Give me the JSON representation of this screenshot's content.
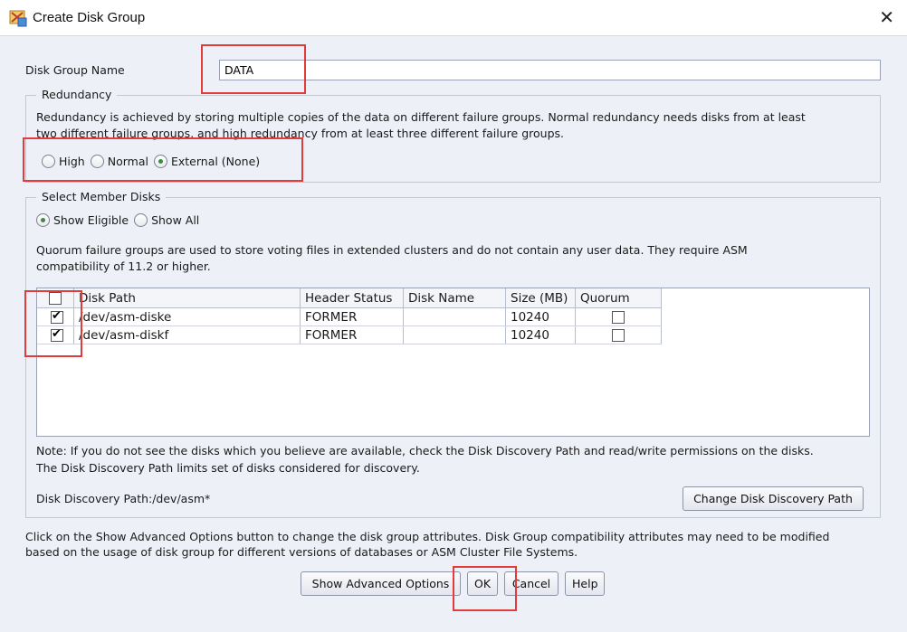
{
  "window": {
    "title": "Create Disk Group",
    "close_glyph": "✕"
  },
  "disk_group_name": {
    "label": "Disk Group Name",
    "value": "DATA"
  },
  "redundancy": {
    "legend": "Redundancy",
    "description_line1": "Redundancy is achieved by storing multiple copies of the data on different failure groups. Normal redundancy needs disks from at least",
    "description_line2": "two different failure groups, and high redundancy from at least three different failure groups.",
    "options": [
      {
        "label": "High",
        "selected": false
      },
      {
        "label": "Normal",
        "selected": false
      },
      {
        "label": "External (None)",
        "selected": true
      }
    ]
  },
  "member_disks": {
    "legend": "Select Member Disks",
    "filter_options": [
      {
        "label": "Show Eligible",
        "selected": true
      },
      {
        "label": "Show All",
        "selected": false
      }
    ],
    "quorum_note_line1": "Quorum failure groups are used to store voting files in extended clusters and do not contain any user data. They require ASM",
    "quorum_note_line2": "compatibility of 11.2 or higher.",
    "table": {
      "columns": [
        "",
        "Disk Path",
        "Header Status",
        "Disk Name",
        "Size (MB)",
        "Quorum"
      ],
      "rows": [
        {
          "selected": true,
          "path": "/dev/asm-diske",
          "header_status": "FORMER",
          "disk_name": "",
          "size_mb": "10240",
          "quorum": false
        },
        {
          "selected": true,
          "path": "/dev/asm-diskf",
          "header_status": "FORMER",
          "disk_name": "",
          "size_mb": "10240",
          "quorum": false
        }
      ]
    },
    "discovery_note_line1": "Note: If you do not see the disks which you believe are available, check the Disk Discovery Path and read/write permissions on the disks.",
    "discovery_note_line2": "The Disk Discovery Path limits set of disks considered for discovery.",
    "discovery_path": "Disk Discovery Path:/dev/asm*",
    "change_path_button": "Change Disk Discovery Path"
  },
  "advanced_note_line1": "Click on the Show Advanced Options button to change the disk group attributes. Disk Group compatibility attributes may need to be modified",
  "advanced_note_line2": "based on the usage of disk group for different versions of databases or ASM Cluster File Systems.",
  "buttons": {
    "advanced": "Show Advanced Options",
    "ok": "OK",
    "cancel": "Cancel",
    "help": "Help"
  },
  "colors": {
    "highlight_box": "#e03c3c",
    "radio_selected": "#3a8c3a",
    "background": "#eef0f7"
  }
}
